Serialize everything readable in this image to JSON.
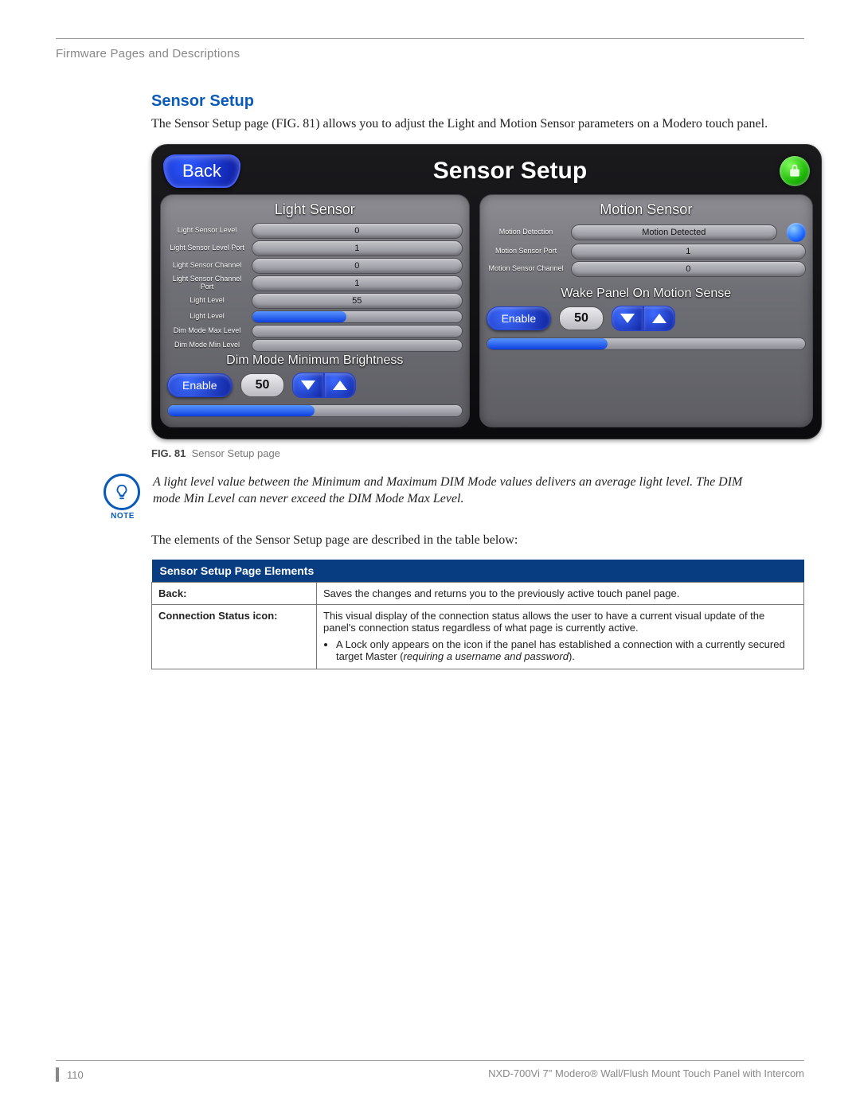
{
  "header": {
    "section": "Firmware Pages and Descriptions"
  },
  "heading": "Sensor Setup",
  "intro": "The Sensor Setup page (FIG. 81) allows you to adjust the Light and Motion Sensor parameters on a Modero touch panel.",
  "panel": {
    "back_label": "Back",
    "title": "Sensor Setup",
    "light": {
      "header": "Light Sensor",
      "rows": [
        {
          "label": "Light Sensor Level",
          "value": "0"
        },
        {
          "label": "Light Sensor Level Port",
          "value": "1"
        },
        {
          "label": "Light Sensor Channel",
          "value": "0"
        },
        {
          "label": "Light Sensor Channel Port",
          "value": "1"
        },
        {
          "label": "Light Level",
          "value": "55"
        }
      ],
      "bar_rows": [
        {
          "label": "Light Level",
          "pct": 45
        },
        {
          "label": "Dim Mode Max Level",
          "pct": 0
        },
        {
          "label": "Dim Mode Min Level",
          "pct": 0
        }
      ],
      "sub_header": "Dim Mode Minimum Brightness",
      "enable_label": "Enable",
      "value": "50",
      "slider_pct": 50
    },
    "motion": {
      "header": "Motion Sensor",
      "rows": [
        {
          "label": "Motion Detection",
          "value": "Motion Detected",
          "orb": true
        },
        {
          "label": "Motion Sensor Port",
          "value": "1"
        },
        {
          "label": "Motion Sensor Channel",
          "value": "0"
        }
      ],
      "sub_header": "Wake Panel On Motion Sense",
      "enable_label": "Enable",
      "value": "50",
      "slider_pct": 38
    }
  },
  "figure": {
    "num": "FIG. 81",
    "caption": "Sensor Setup page"
  },
  "note": {
    "label": "NOTE",
    "text": "A light level value between the Minimum and Maximum DIM Mode values delivers an average light level. The DIM mode Min Level can never exceed the DIM Mode Max Level."
  },
  "table_intro": "The elements of the Sensor Setup page are described in the table below:",
  "table": {
    "header": "Sensor Setup Page Elements",
    "rows": [
      {
        "key": "Back:",
        "desc": "Saves the changes and returns you to the previously active touch panel page."
      },
      {
        "key": "Connection Status icon:",
        "desc": "This visual display of the connection status allows the user to have a current visual update of the panel's connection status regardless of what page is currently active.",
        "bullet": "A Lock only appears on the icon if the panel has established a connection with a currently secured target Master (",
        "bullet_ital": "requiring a username and password",
        "bullet_tail": ")."
      }
    ]
  },
  "footer": {
    "page": "110",
    "doc": "NXD-700Vi 7\" Modero® Wall/Flush Mount Touch Panel with Intercom"
  }
}
